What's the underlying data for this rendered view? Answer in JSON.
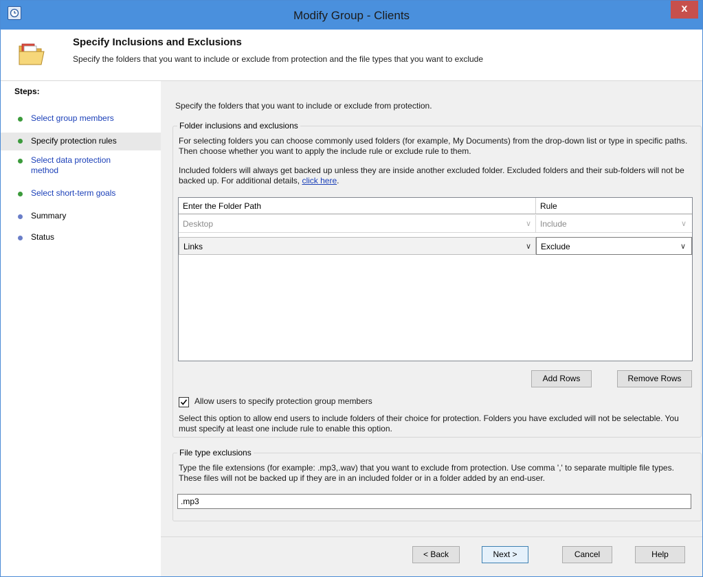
{
  "window": {
    "title": "Modify Group - Clients",
    "close_glyph": "x"
  },
  "header": {
    "title": "Specify Inclusions and Exclusions",
    "subtitle": "Specify the folders that you want to include or exclude from protection and the file types that you want to exclude",
    "icon": "folder-icon"
  },
  "steps": {
    "label": "Steps:",
    "items": [
      {
        "label": "Select group members",
        "state": "link",
        "dot_color": "#3c9b3c"
      },
      {
        "label": "Specify protection rules",
        "state": "current",
        "dot_color": "#3c9b3c"
      },
      {
        "label": "Select data protection method",
        "state": "link",
        "dot_color": "#3c9b3c"
      },
      {
        "label": "Select short-term goals",
        "state": "link",
        "dot_color": "#3c9b3c"
      },
      {
        "label": "Summary",
        "state": "pending",
        "dot_color": "#6a7ec8"
      },
      {
        "label": "Status",
        "state": "pending",
        "dot_color": "#6a7ec8"
      }
    ]
  },
  "main": {
    "intro": "Specify the folders that you want to include or exclude from protection.",
    "folder_group": {
      "title": "Folder inclusions and exclusions",
      "desc1": "For selecting folders you can choose commonly used folders (for example, My Documents) from the drop-down list or type in specific paths. Then choose whether you want to apply the include rule or exclude rule to them.",
      "desc2": "Included folders will always get backed up unless they are inside another excluded folder. Excluded folders and their sub-folders will not be backed up. For additional details,",
      "link": "click here",
      "after_link": ".",
      "grid": {
        "col_path": "Enter the Folder Path",
        "col_rule": "Rule",
        "rows": [
          {
            "path": "Desktop",
            "rule": "Include",
            "enabled": false
          },
          {
            "path": "Links",
            "rule": "Exclude",
            "enabled": true
          }
        ]
      },
      "add_rows": "Add Rows",
      "remove_rows": "Remove Rows",
      "allow_users": {
        "label": "Allow users to specify protection group members",
        "checked": true,
        "desc": "Select this option to allow end users to include folders of their choice for protection. Folders you have excluded will not be selectable. You must specify at least one include rule to enable this option."
      }
    },
    "file_type": {
      "title": "File type exclusions",
      "desc": "Type the file extensions (for example: .mp3,.wav) that you want to exclude from protection. Use comma ',' to separate multiple file types. These files will not be backed up if they are in an included folder or in a folder added by an end-user.",
      "value": ".mp3"
    }
  },
  "footer": {
    "back": "< Back",
    "next": "Next >",
    "cancel": "Cancel",
    "help": "Help"
  },
  "colors": {
    "titlebar": "#4a90dd",
    "close": "#c7504c",
    "link": "#1a3fb8"
  }
}
